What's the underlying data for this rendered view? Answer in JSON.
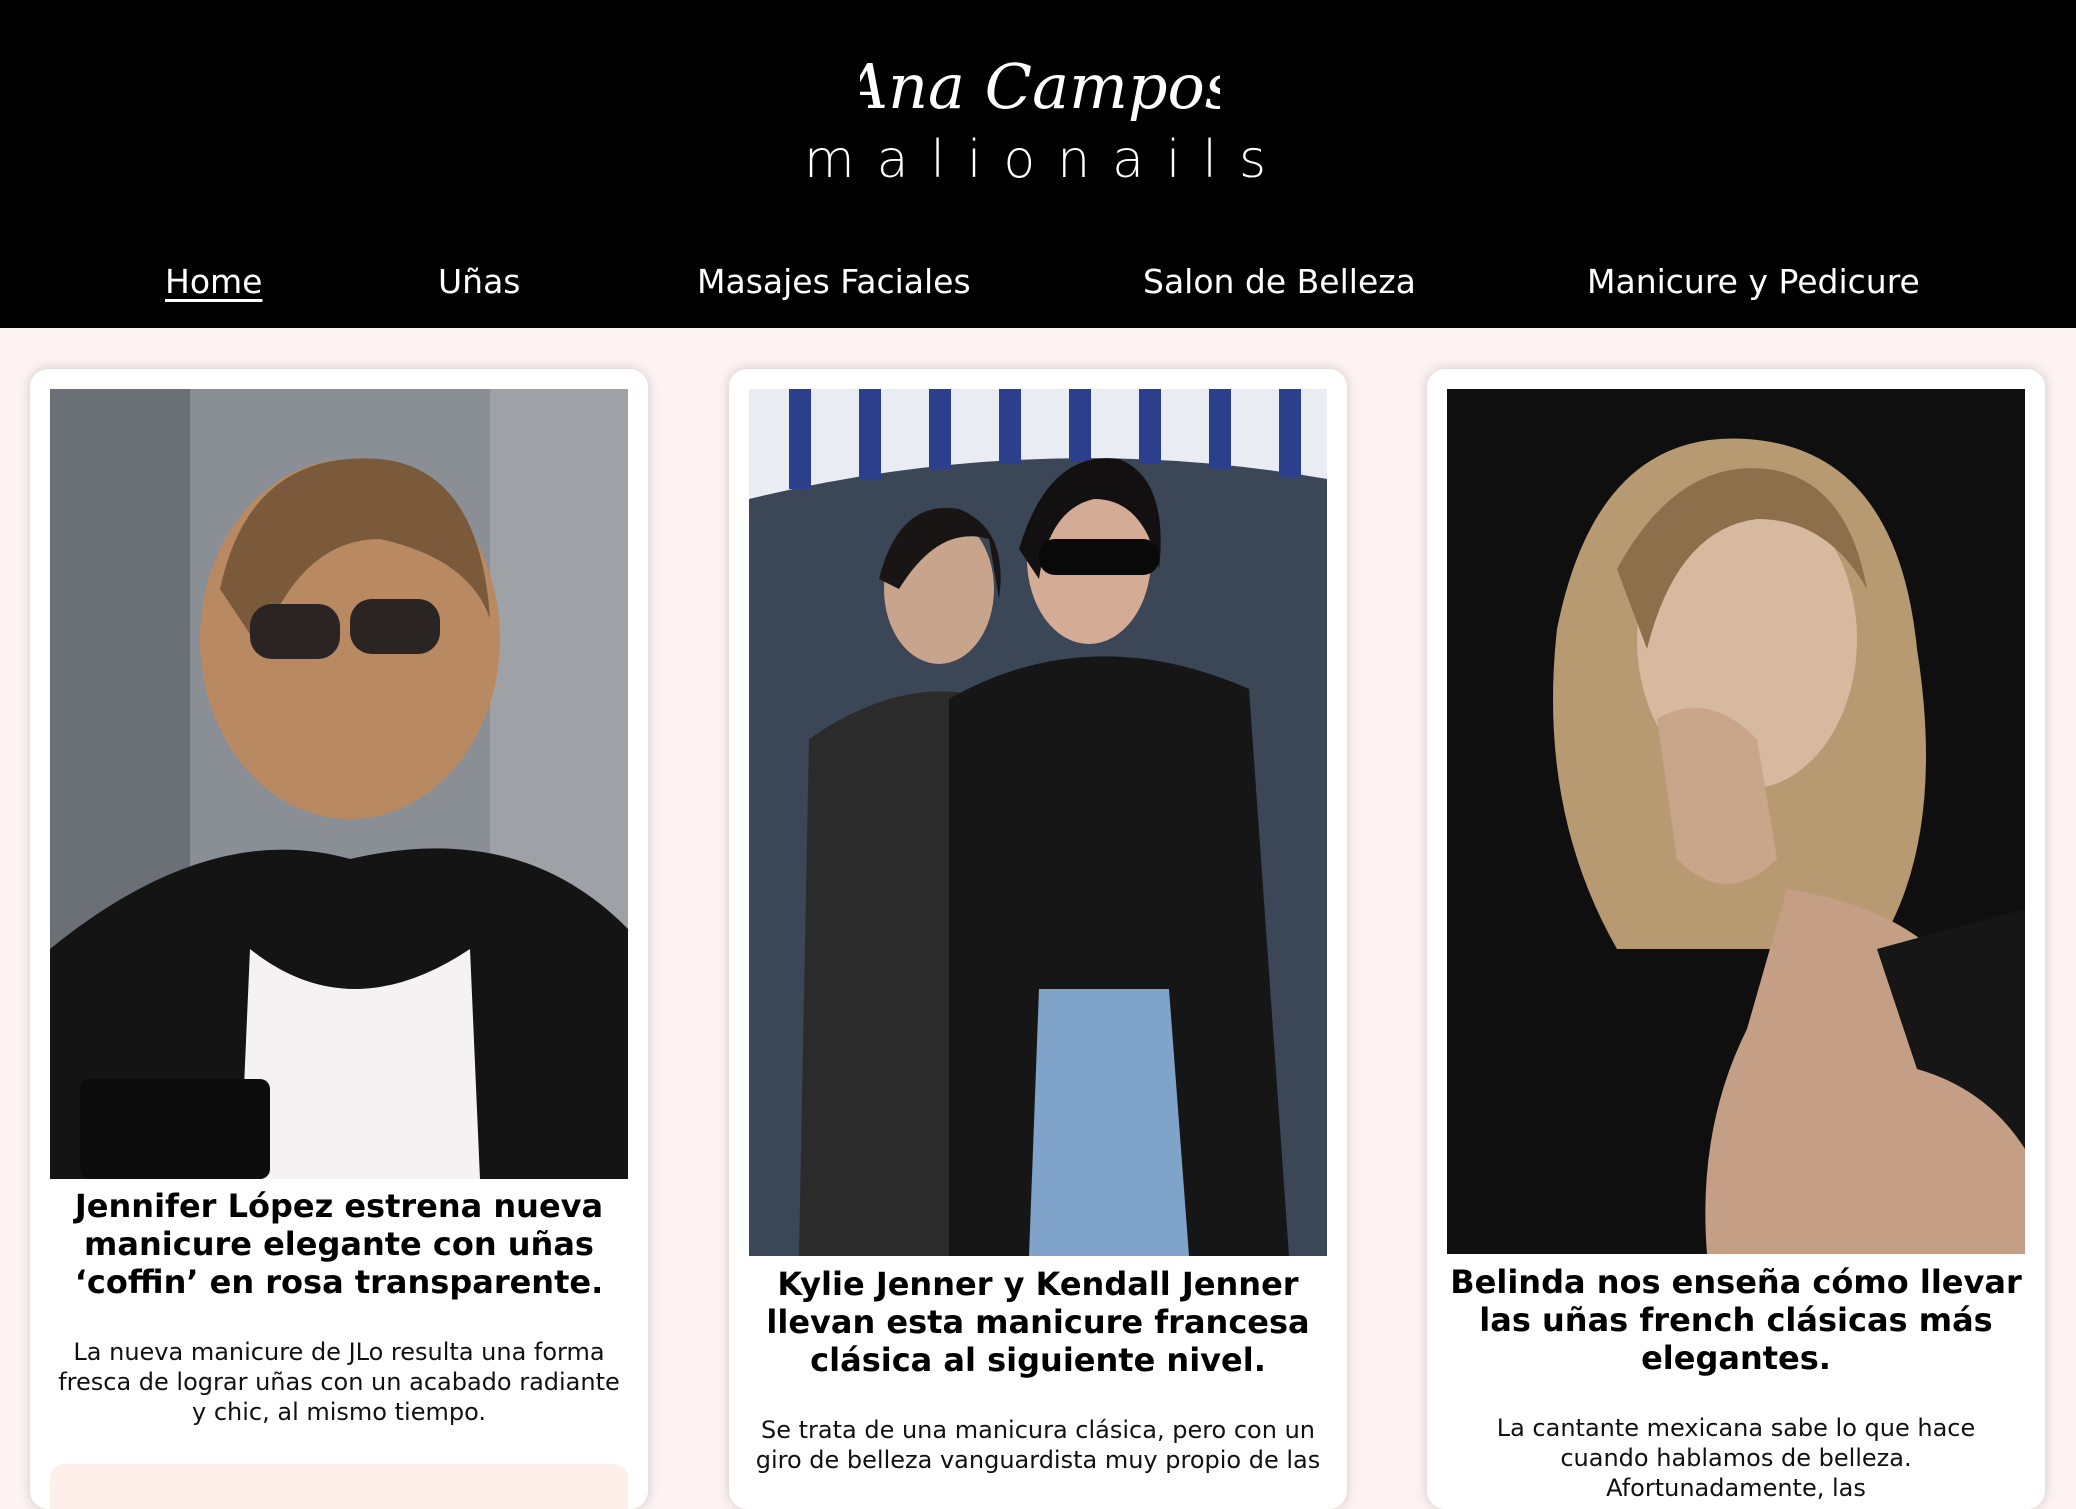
{
  "header": {
    "logo": {
      "script_text": "Ana Campos",
      "word_text": "malionails"
    },
    "nav": [
      {
        "label": "Home",
        "active": true
      },
      {
        "label": "Uñas",
        "active": false
      },
      {
        "label": "Masajes Faciales",
        "active": false
      },
      {
        "label": "Salon de Belleza",
        "active": false
      },
      {
        "label": "Manicure y Pedicure",
        "active": false
      }
    ]
  },
  "colors": {
    "header_bg": "#000000",
    "page_bg": "#fdf3f3",
    "card_bg": "#ffffff",
    "button_bg": "#fdf0ea"
  },
  "cards": [
    {
      "image_icon": "photo-jennifer-lopez",
      "title": "Jennifer López estrena nueva manicure elegante con uñas ‘coffin’ en rosa transparente.",
      "excerpt": "La nueva manicure de JLo resulta una forma fresca de lograr uñas con un acabado radiante y chic, al mismo tiempo."
    },
    {
      "image_icon": "photo-kylie-kendall-jenner",
      "title": "Kylie Jenner y Kendall Jenner llevan esta manicure francesa clásica al siguiente nivel.",
      "excerpt": "Se trata de una manicura clásica, pero con un giro de belleza vanguardista muy propio de las"
    },
    {
      "image_icon": "photo-belinda",
      "title": "Belinda nos enseña cómo llevar las uñas french clásicas más elegantes.",
      "excerpt": "La cantante mexicana sabe lo que hace cuando hablamos de belleza. Afortunadamente, las"
    }
  ]
}
